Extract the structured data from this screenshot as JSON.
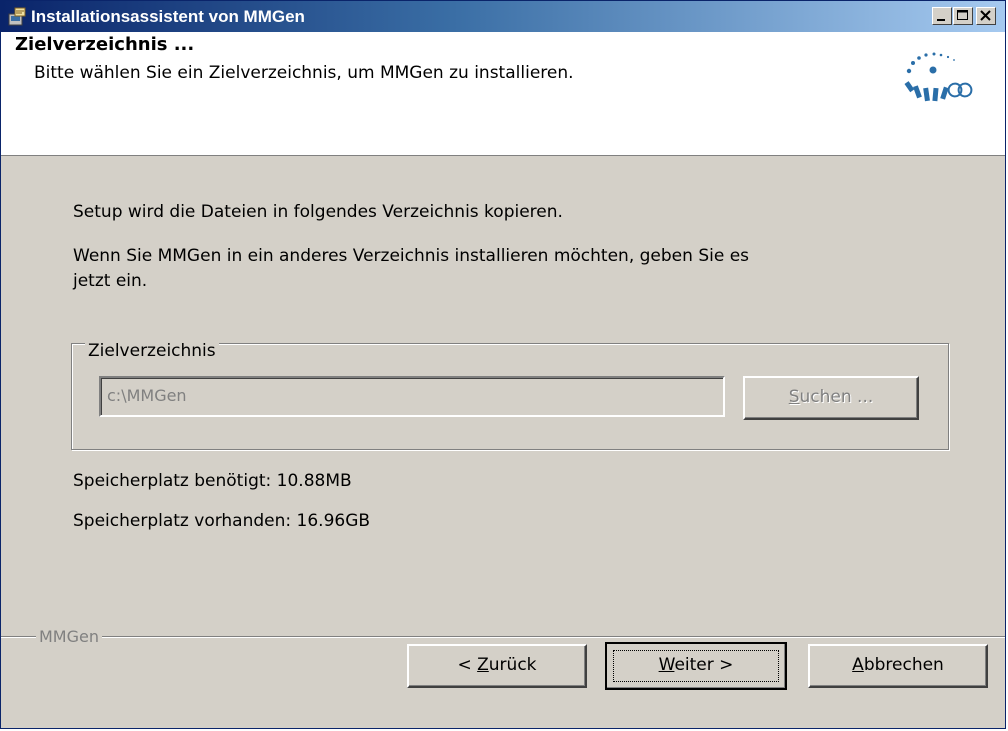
{
  "window": {
    "title": "Installationsassistent von MMGen",
    "title_bar_buttons": [
      "minimize",
      "maximize",
      "close"
    ]
  },
  "header": {
    "title": "Zielverzeichnis ...",
    "subtitle": "Bitte wählen Sie ein Zielverzeichnis, um MMGen zu installieren."
  },
  "content": {
    "intro": "Setup wird die Dateien in folgendes Verzeichnis kopieren.",
    "instruction_line1": "Wenn Sie MMGen in ein anderes Verzeichnis installieren möchten, geben Sie es",
    "instruction_line2": "jetzt ein.",
    "group_label": "Zielverzeichnis",
    "path_value": "c:\\MMGen",
    "browse_label_pre": "",
    "browse_label_key": "S",
    "browse_label_post": "uchen ...",
    "space_required": "Speicherplatz benötigt: 10.88MB",
    "space_available": "Speicherplatz vorhanden: 16.96GB"
  },
  "footer": {
    "brand": "MMGen",
    "back_pre": "< ",
    "back_key": "Z",
    "back_post": "urück",
    "next_key": "W",
    "next_post": "eiter >",
    "cancel_key": "A",
    "cancel_post": "bbrechen"
  },
  "colors": {
    "dialog_bg": "#d4d0c8",
    "title_gradient_start": "#0a246a",
    "title_gradient_end": "#a6caf0",
    "disabled_text": "#808080"
  }
}
